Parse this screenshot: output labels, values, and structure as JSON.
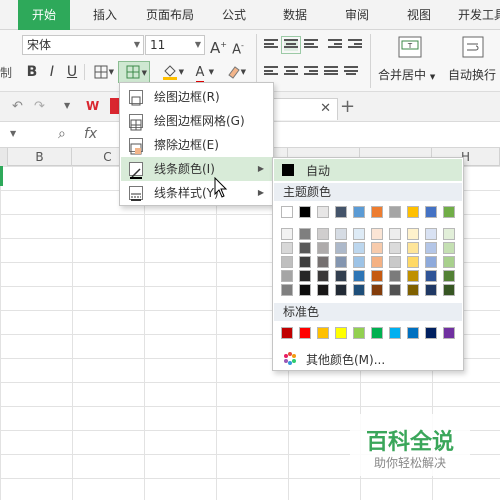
{
  "ribbon_tabs": [
    "开始",
    "插入",
    "页面布局",
    "公式",
    "数据",
    "审阅",
    "视图",
    "开发工具"
  ],
  "ribbon": {
    "font_name": "宋体",
    "font_size": "11",
    "grow_font": "A",
    "shrink_font": "A",
    "bold": "B",
    "italic": "I",
    "underline": "U",
    "fill_color_label": "A",
    "merge_center_label": "合并居中",
    "wrap_text_label": "自动换行",
    "left_cut_label": "制"
  },
  "formula_bar": {
    "fx_label": "fx"
  },
  "columns": [
    "B",
    "C",
    "H"
  ],
  "border_menu": {
    "items": [
      {
        "label": "绘图边框(R)",
        "icon": "draw-border-icon"
      },
      {
        "label": "绘图边框网格(G)",
        "icon": "draw-border-grid-icon"
      },
      {
        "label": "擦除边框(E)",
        "icon": "erase-border-icon"
      },
      {
        "label": "线条颜色(I)",
        "icon": "line-color-icon"
      },
      {
        "label": "线条样式(Y)",
        "icon": "line-style-icon"
      }
    ]
  },
  "color_panel": {
    "auto_label": "自动",
    "theme_label": "主题颜色",
    "standard_label": "标准色",
    "more_label": "其他颜色(M)...",
    "theme_colors": [
      [
        "#ffffff",
        "#000000",
        "#e7e6e6",
        "#44546a",
        "#5b9bd5",
        "#ed7d31",
        "#a5a5a5",
        "#ffc000",
        "#4472c4",
        "#70ad47"
      ],
      [
        "#f2f2f2",
        "#7f7f7f",
        "#d0cece",
        "#d6dce4",
        "#deebf6",
        "#fbe5d5",
        "#ededed",
        "#fff2cc",
        "#d9e2f3",
        "#e2efd9"
      ],
      [
        "#d8d8d8",
        "#595959",
        "#aeabab",
        "#adb9ca",
        "#bdd7ee",
        "#f7cbac",
        "#dbdbdb",
        "#fee599",
        "#b4c6e7",
        "#c5e0b3"
      ],
      [
        "#bfbfbf",
        "#3f3f3f",
        "#757070",
        "#8496b0",
        "#9dc3e6",
        "#f4b183",
        "#c9c9c9",
        "#ffd965",
        "#8eaadb",
        "#a8d08d"
      ],
      [
        "#a5a5a5",
        "#262626",
        "#3a3838",
        "#323f4f",
        "#2e75b5",
        "#c55a11",
        "#7b7b7b",
        "#bf9000",
        "#2f5496",
        "#538135"
      ],
      [
        "#7f7f7f",
        "#0c0c0c",
        "#171616",
        "#222a35",
        "#1e4e79",
        "#833c0b",
        "#525252",
        "#7f6000",
        "#1f3864",
        "#375623"
      ]
    ],
    "standard_colors": [
      "#c00000",
      "#ff0000",
      "#ffc000",
      "#ffff00",
      "#92d050",
      "#00b050",
      "#00b0f0",
      "#0070c0",
      "#002060",
      "#7030a0"
    ]
  },
  "watermark": {
    "title": "百科全说",
    "subtitle": "助你轻松解决"
  }
}
